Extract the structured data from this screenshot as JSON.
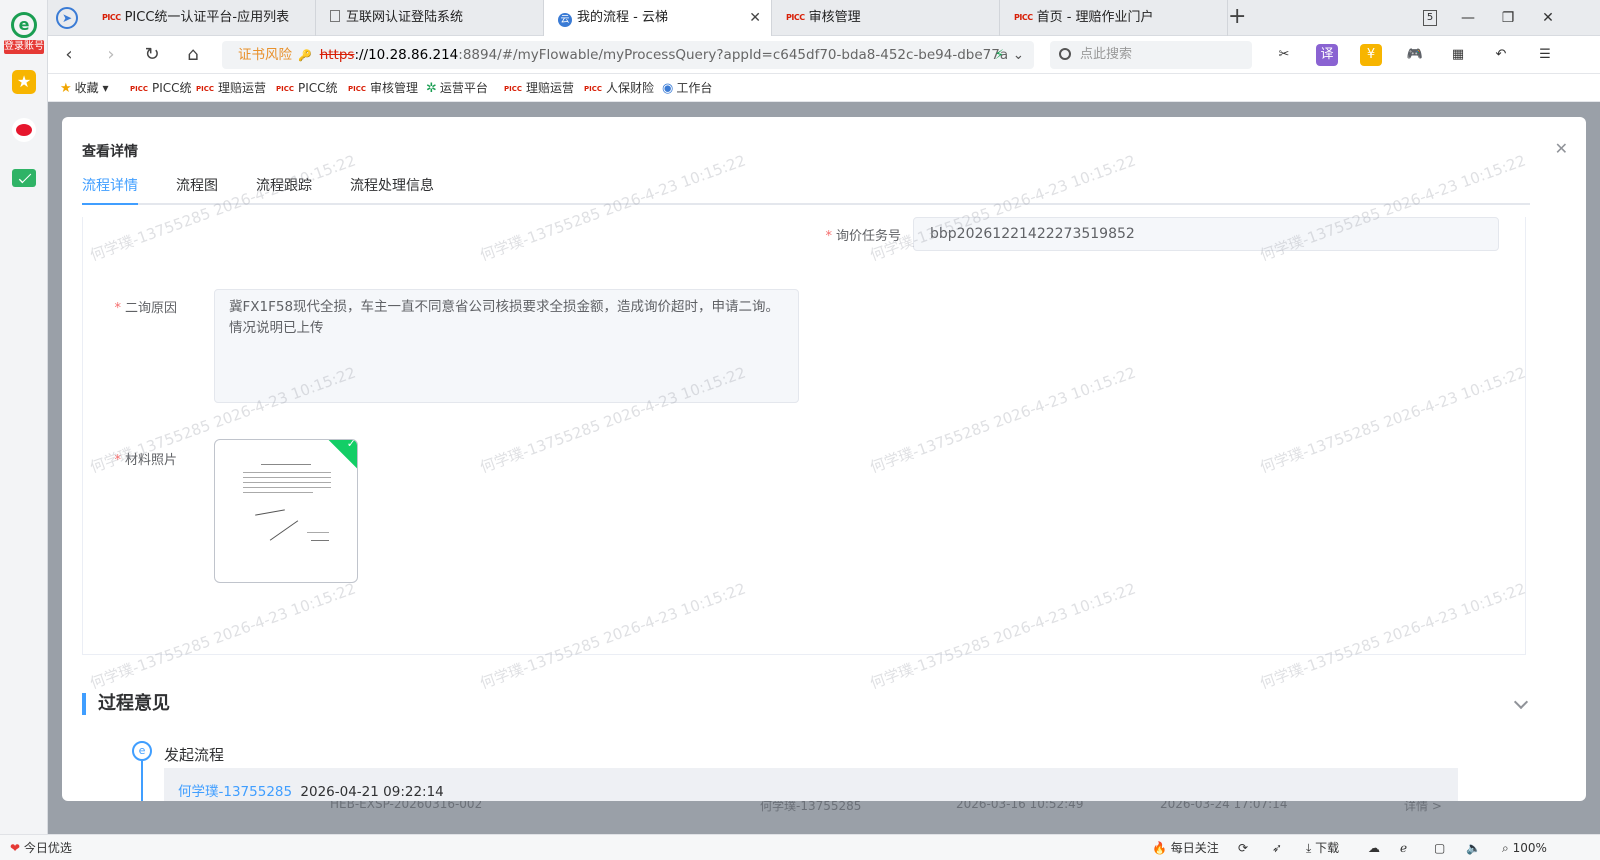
{
  "sidebar": {
    "login_tag": "登录账号"
  },
  "browser_tabs": [
    {
      "label": "PICC统一认证平台-应用列表",
      "active": false,
      "icon": "picc-logo-icon"
    },
    {
      "label": "互联网认证登陆系统",
      "active": false,
      "icon": "document-icon"
    },
    {
      "label": "我的流程 - 云梯",
      "active": true,
      "icon": "yunti-icon"
    },
    {
      "label": "审核管理",
      "active": false,
      "icon": "picc-logo-icon"
    },
    {
      "label": "首页 - 理赔作业门户",
      "active": false,
      "icon": "picc-logo-icon"
    }
  ],
  "window": {
    "tab_count": "5"
  },
  "address": {
    "risk_label": "证书风险",
    "scheme": "https",
    "host": "://10.28.86.214",
    "path": ":8894/#/myFlowable/myProcessQuery?appId=c645df70-bda8-452c-be94-dbe77a",
    "search_placeholder": "点此搜索"
  },
  "bookmarks": [
    "收藏",
    "PICC统",
    "理赔运营",
    "PICC统",
    "审核管理",
    "运营平台",
    "理赔运营",
    "人保财险",
    "工作台"
  ],
  "modal": {
    "title": "查看详情",
    "tabs": [
      "流程详情",
      "流程图",
      "流程跟踪",
      "流程处理信息"
    ],
    "fields": {
      "task_no_label": "询价任务号",
      "task_no_value": "bbp20261221422273519852",
      "reason_label": "二询原因",
      "reason_value": "冀FX1F58现代全损，车主一直不同意省公司核损要求全损金额，造成询价超时，申请二询。情况说明已上传",
      "photo_label": "材料照片"
    },
    "section_title": "过程意见",
    "flow": {
      "step_title": "发起流程",
      "user": "何学璞-13755285",
      "time": "2026-04-21 09:22:14"
    }
  },
  "background_row": {
    "code": "HEB-EXSP-20260316-002",
    "user": "何学璞-13755285",
    "start": "2026-03-16 10:52:49",
    "end": "2026-03-24 17:07:14",
    "link": "详情 >"
  },
  "watermark": "何学璞-13755285  2026-4-23 10:15:22",
  "status_bar": {
    "left": "今日优选",
    "daily": "每日关注",
    "download": "下载",
    "zoom": "100%"
  }
}
